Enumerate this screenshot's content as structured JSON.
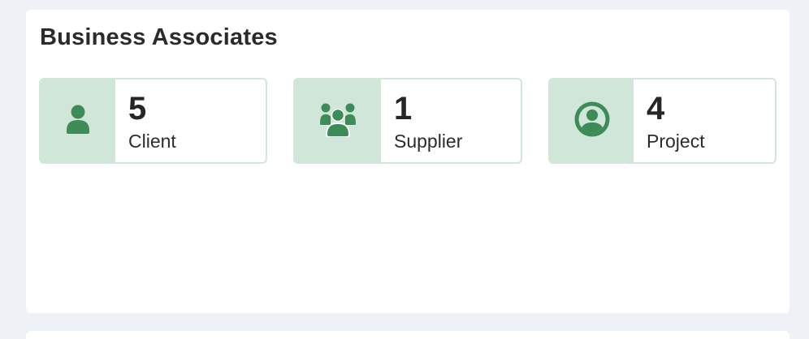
{
  "section": {
    "title": "Business Associates"
  },
  "cards": [
    {
      "count": "5",
      "label": "Client",
      "icon": "person-icon"
    },
    {
      "count": "1",
      "label": "Supplier",
      "icon": "users-group-icon"
    },
    {
      "count": "4",
      "label": "Project",
      "icon": "user-circle-icon"
    }
  ],
  "colors": {
    "accent": "#3d8c57",
    "icon_bg": "#cfe6d8",
    "card_border": "#d3e6db",
    "page_bg": "#eef2f7"
  }
}
